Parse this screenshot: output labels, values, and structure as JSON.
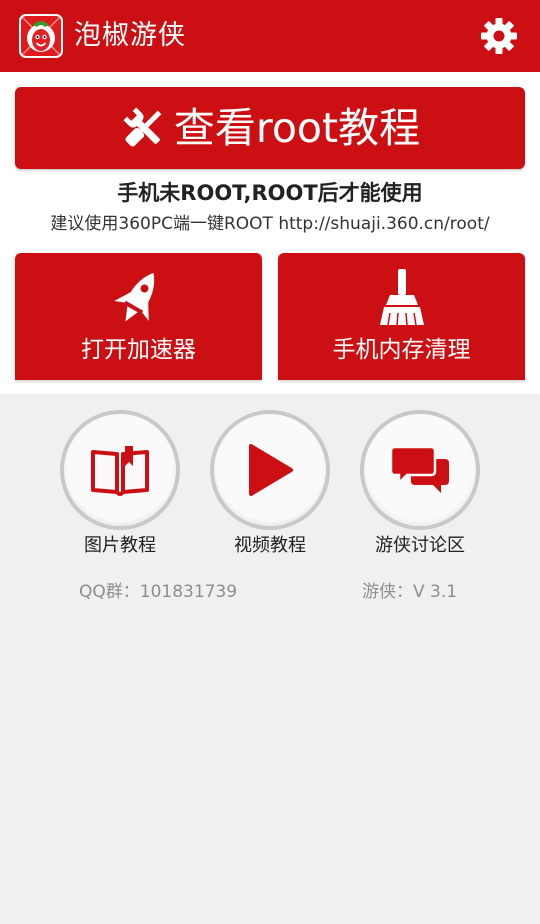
{
  "app": {
    "title": "泡椒游侠",
    "logo_icon": "chili-pepper-logo",
    "settings_icon": "gear-icon"
  },
  "colors": {
    "brand_red": "#cc0f12",
    "background": "#f0f0f0",
    "muted_text": "#8e8e8e"
  },
  "root_tutorial": {
    "label": "查看root教程",
    "icon": "wrench-screwdriver-icon"
  },
  "notice": {
    "warning": "手机未ROOT,ROOT后才能使用",
    "hint": "建议使用360PC端一键ROOT http://shuaji.360.cn/root/"
  },
  "tiles": [
    {
      "label": "打开加速器",
      "icon": "rocket-icon"
    },
    {
      "label": "手机内存清理",
      "icon": "broom-icon"
    }
  ],
  "circle_buttons": [
    {
      "label": "图片教程",
      "icon": "book-icon"
    },
    {
      "label": "视频教程",
      "icon": "play-icon"
    },
    {
      "label": "游侠讨论区",
      "icon": "chat-bubbles-icon"
    }
  ],
  "footer": {
    "qq_group": "QQ群：101831739",
    "version": "游侠：V 3.1"
  }
}
